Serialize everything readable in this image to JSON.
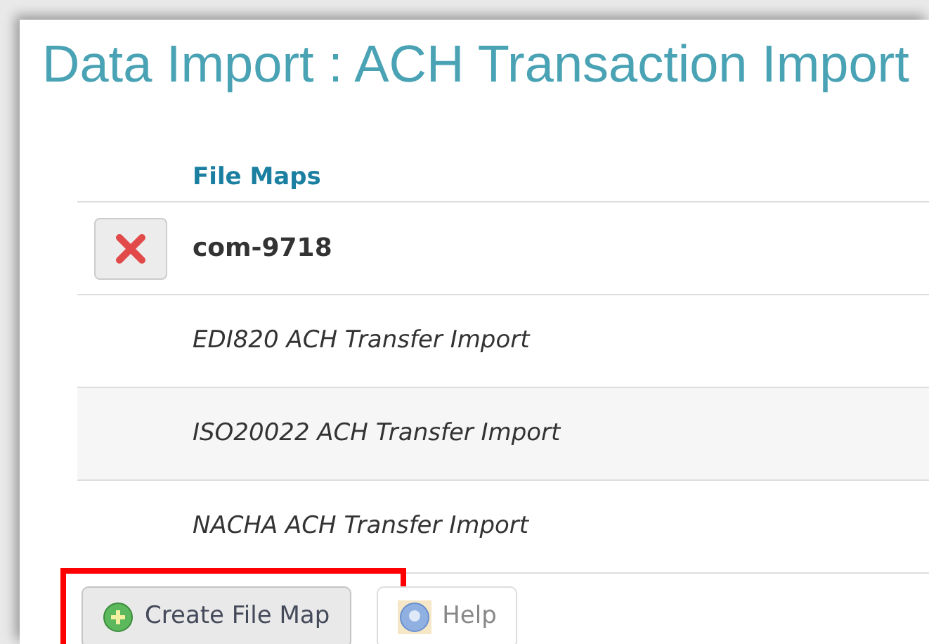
{
  "title": "Data Import : ACH Transaction Import",
  "table": {
    "columns": [
      "File Maps"
    ],
    "rows": [
      {
        "kind": "custom",
        "name": "com-9718"
      },
      {
        "kind": "builtin",
        "name": "EDI820 ACH Transfer Import"
      },
      {
        "kind": "builtin",
        "name": "ISO20022 ACH Transfer Import"
      },
      {
        "kind": "builtin",
        "name": "NACHA ACH Transfer Import"
      }
    ]
  },
  "buttons": [
    {
      "kind": "create",
      "label": "Create File Map",
      "highlighted": true,
      "disabled": false
    },
    {
      "kind": "help",
      "label": "Help",
      "highlighted": false,
      "disabled": true
    }
  ]
}
